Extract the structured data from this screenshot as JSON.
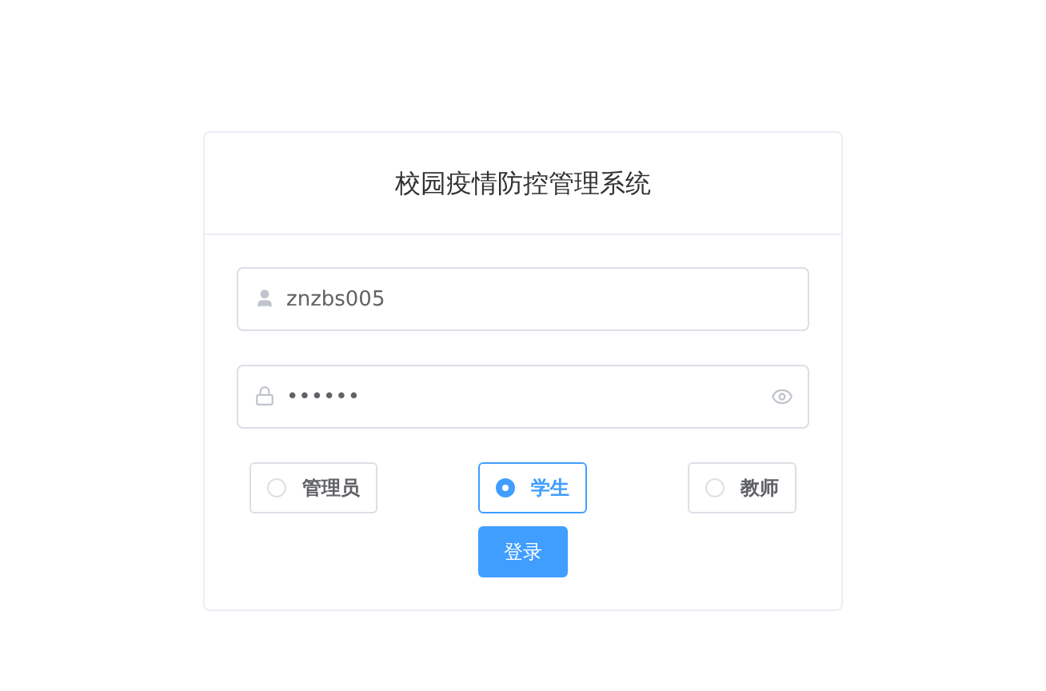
{
  "title": "校园疫情防控管理系统",
  "username": {
    "value": "znzbs005"
  },
  "password": {
    "value": "••••••"
  },
  "roles": [
    {
      "label": "管理员",
      "selected": false
    },
    {
      "label": "学生",
      "selected": true
    },
    {
      "label": "教师",
      "selected": false
    }
  ],
  "login_button": "登录"
}
